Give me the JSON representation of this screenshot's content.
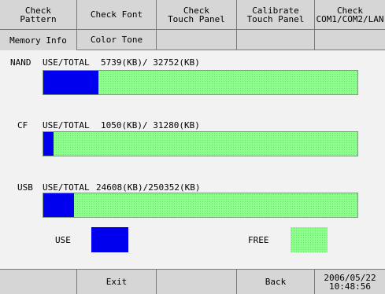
{
  "top_tabs": [
    {
      "label": "Check\nPattern"
    },
    {
      "label": "Check Font"
    },
    {
      "label": "Check\nTouch Panel"
    },
    {
      "label": "Calibrate\nTouch Panel"
    },
    {
      "label": "Check\nCOM1/COM2/LAN"
    }
  ],
  "sub_tabs": [
    {
      "label": "Memory Info"
    },
    {
      "label": "Color Tone"
    }
  ],
  "memory": [
    {
      "name": "NAND",
      "caption": "USE/TOTAL",
      "values": "5739(KB)/ 32752(KB)",
      "used_fraction": 0.1752
    },
    {
      "name": "CF",
      "caption": "USE/TOTAL",
      "values": "1050(KB)/ 31280(KB)",
      "used_fraction": 0.0336
    },
    {
      "name": "USB",
      "caption": "USE/TOTAL",
      "values": "24608(KB)/250352(KB)",
      "used_fraction": 0.0983
    }
  ],
  "legend": {
    "use_label": "USE",
    "free_label": "FREE",
    "use_color": "#0000ee",
    "free_color": "#8cff8c"
  },
  "footer": {
    "exit_label": "Exit",
    "back_label": "Back",
    "datetime": "2006/05/22\n10:48:56"
  }
}
